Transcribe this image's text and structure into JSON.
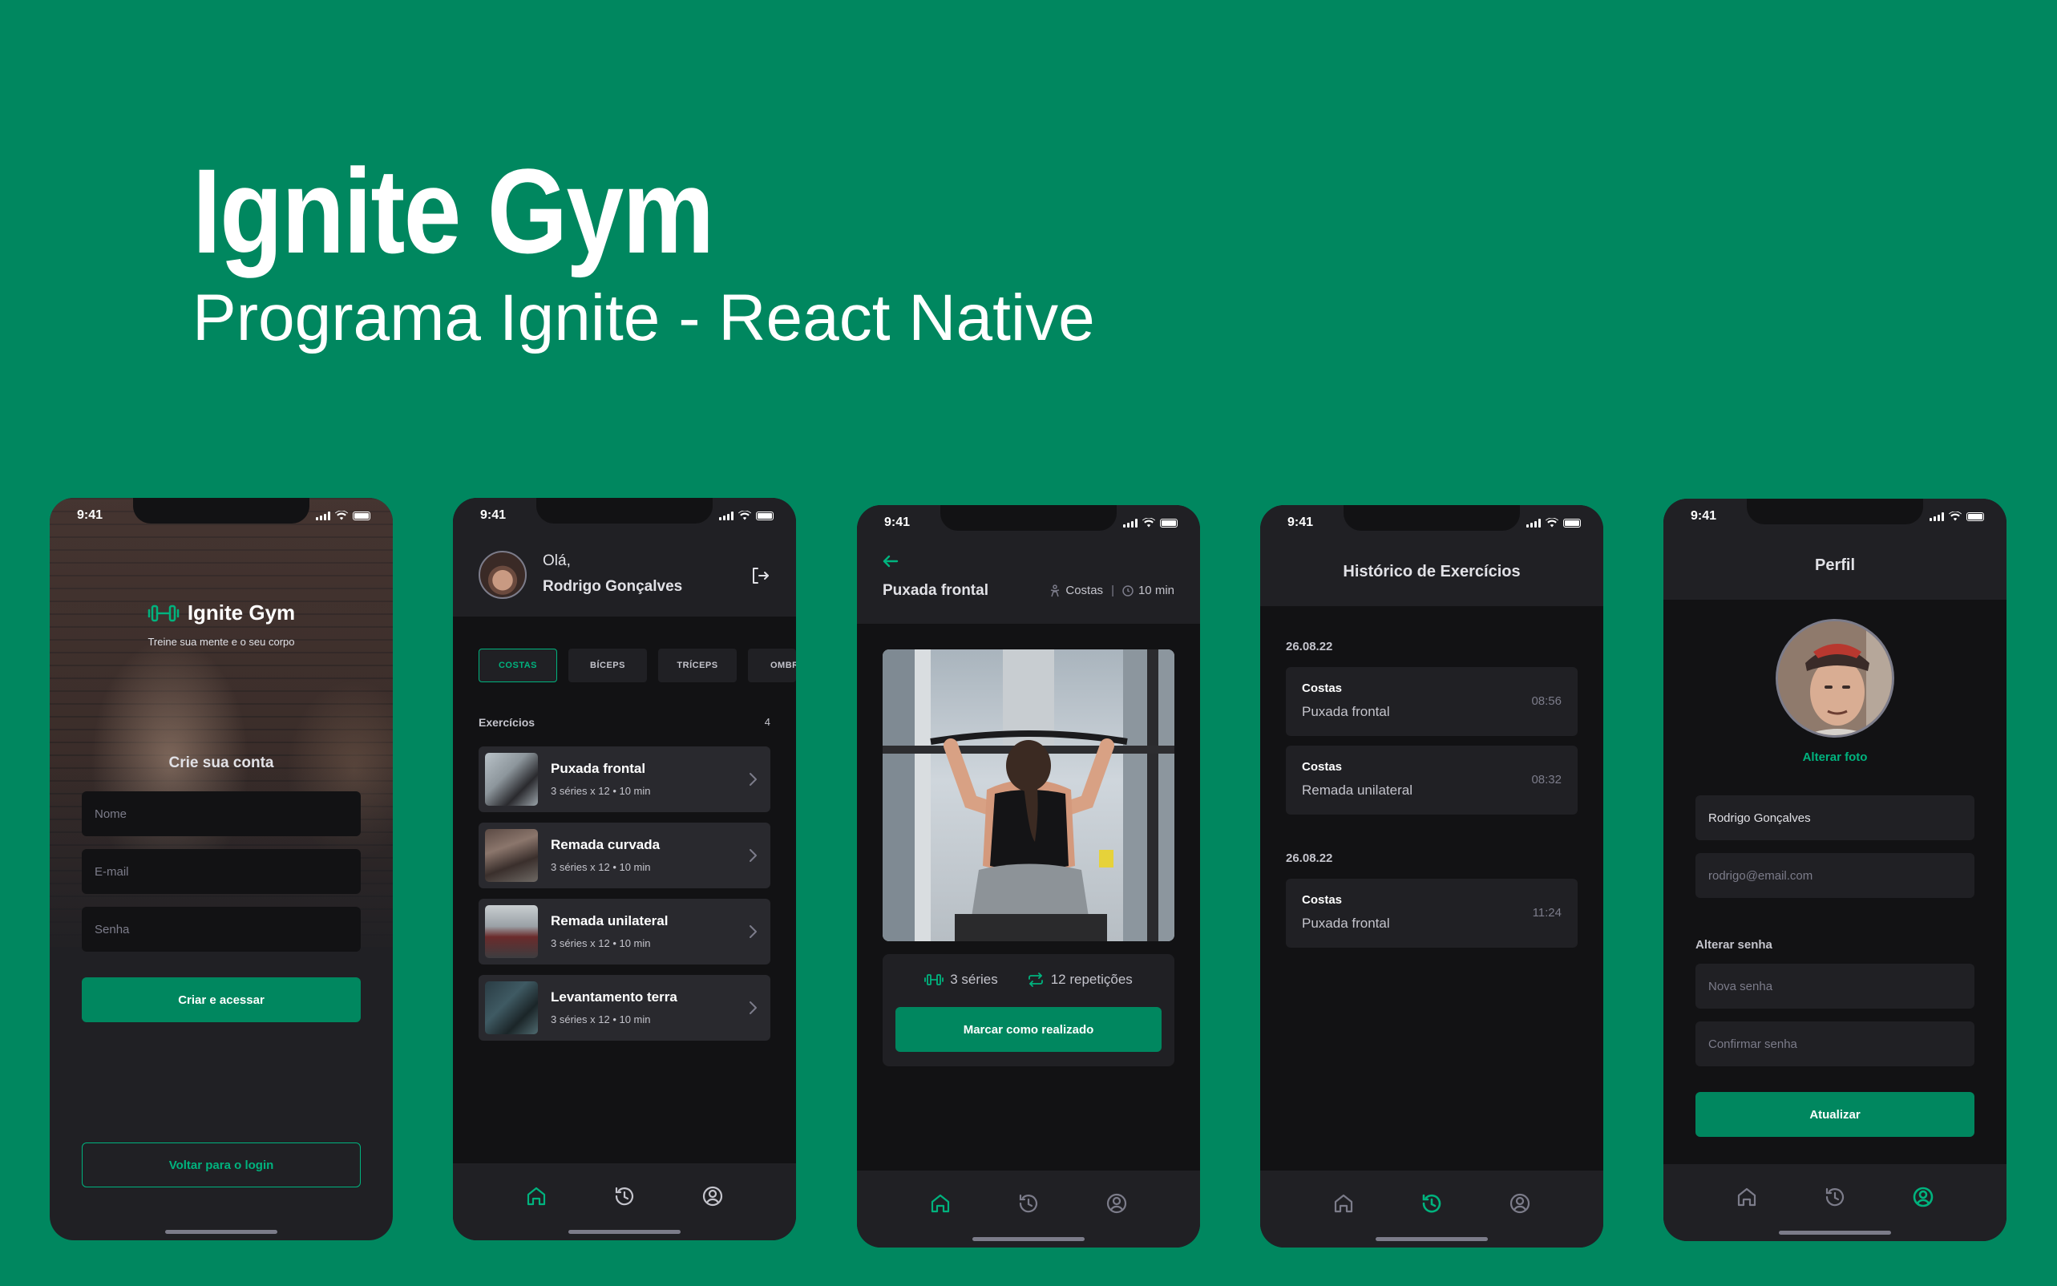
{
  "hero": {
    "title": "Ignite Gym",
    "subtitle": "Programa Ignite - React Native"
  },
  "status_time": "9:41",
  "colors": {
    "background": "#00875F",
    "accent": "#00B37E",
    "button": "#00875F",
    "surface": "#202024",
    "card": "#29292E",
    "app_bg": "#121214"
  },
  "signup": {
    "logo_text": "Ignite Gym",
    "tagline": "Treine sua mente e o seu corpo",
    "heading": "Crie sua conta",
    "name_placeholder": "Nome",
    "email_placeholder": "E-mail",
    "password_placeholder": "Senha",
    "submit_label": "Criar e acessar",
    "back_label": "Voltar para o login"
  },
  "home": {
    "greeting": "Olá,",
    "user_name": "Rodrigo Gonçalves",
    "groups": [
      "COSTAS",
      "BÍCEPS",
      "TRÍCEPS",
      "OMBR"
    ],
    "active_group": "COSTAS",
    "list_title": "Exercícios",
    "count": "4",
    "exercises": [
      {
        "name": "Puxada frontal",
        "meta": "3 séries x 12 • 10 min"
      },
      {
        "name": "Remada curvada",
        "meta": "3 séries x 12 • 10 min"
      },
      {
        "name": "Remada unilateral",
        "meta": "3 séries x 12 • 10 min"
      },
      {
        "name": "Levantamento terra",
        "meta": "3 séries x 12 • 10 min"
      }
    ]
  },
  "exercise": {
    "title": "Puxada frontal",
    "group": "Costas",
    "duration": "10 min",
    "series": "3 séries",
    "reps": "12 repetições",
    "mark_label": "Marcar como realizado"
  },
  "history": {
    "title": "Histórico de Exercícios",
    "sections": [
      {
        "date": "26.08.22",
        "items": [
          {
            "group": "Costas",
            "name": "Puxada frontal",
            "time": "08:56"
          },
          {
            "group": "Costas",
            "name": "Remada unilateral",
            "time": "08:32"
          }
        ]
      },
      {
        "date": "26.08.22",
        "items": [
          {
            "group": "Costas",
            "name": "Puxada frontal",
            "time": "11:24"
          }
        ]
      }
    ]
  },
  "profile": {
    "title": "Perfil",
    "change_photo": "Alterar foto",
    "name_value": "Rodrigo Gonçalves",
    "email_value": "rodrigo@email.com",
    "change_password_label": "Alterar senha",
    "new_password_placeholder": "Nova senha",
    "confirm_password_placeholder": "Confirmar senha",
    "submit_label": "Atualizar"
  },
  "tabs": {
    "home_icon": "home-icon",
    "history_icon": "history-icon",
    "profile_icon": "profile-icon"
  }
}
